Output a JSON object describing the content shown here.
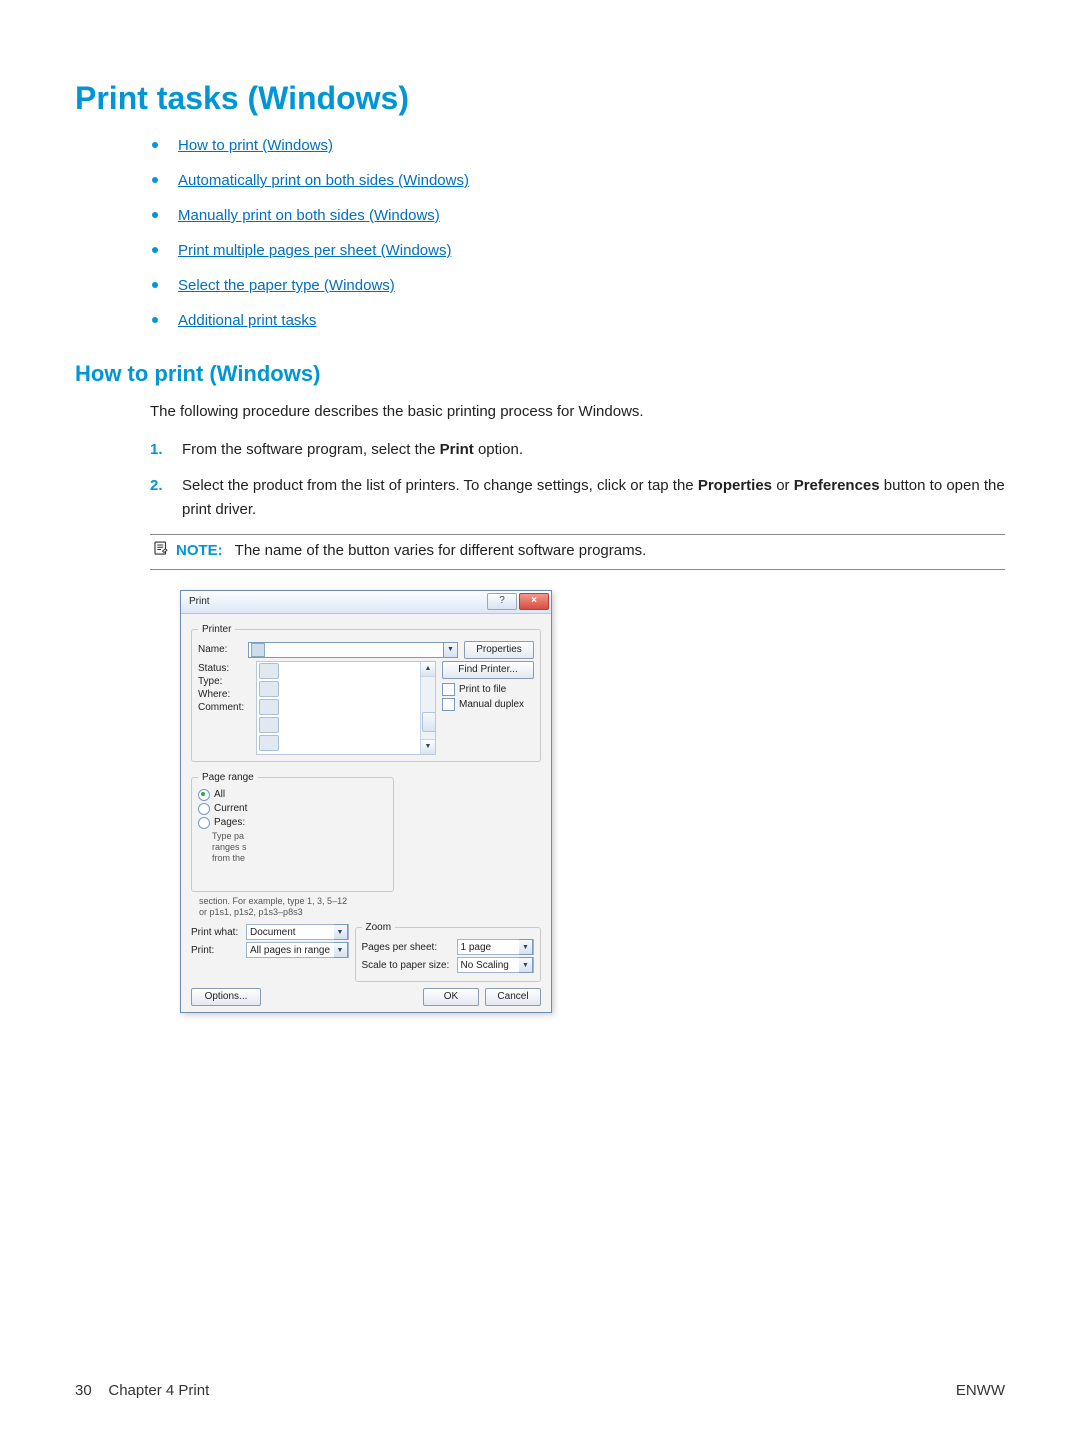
{
  "h1": "Print tasks (Windows)",
  "toc": [
    "How to print (Windows)",
    "Automatically print on both sides (Windows)",
    "Manually print on both sides (Windows)",
    "Print multiple pages per sheet (Windows)",
    "Select the paper type (Windows)",
    "Additional print tasks"
  ],
  "h2": "How to print (Windows)",
  "intro": "The following procedure describes the basic printing process for Windows.",
  "step1_a": "From the software program, select the ",
  "step1_b": "Print",
  "step1_c": " option.",
  "step2_a": "Select the product from the list of printers. To change settings, click or tap the ",
  "step2_b": "Properties",
  "step2_c": " or ",
  "step2_d": "Preferences",
  "step2_e": " button to open the print driver.",
  "note_label": "NOTE:",
  "note_text": "The name of the button varies for different software programs.",
  "dlg": {
    "title": "Print",
    "help_btn": "?",
    "close_btn": "×",
    "printer_group": "Printer",
    "name_lbl": "Name:",
    "status_lbl": "Status:",
    "type_lbl": "Type:",
    "where_lbl": "Where:",
    "comment_lbl": "Comment:",
    "properties_btn": "Properties",
    "find_printer_btn": "Find Printer...",
    "print_to_file": "Print to file",
    "manual_duplex": "Manual duplex",
    "page_range_group": "Page range",
    "range_all": "All",
    "range_current": "Current",
    "range_pages": "Pages:",
    "range_hint1": "Type pa",
    "range_hint2": "ranges s",
    "range_hint3": "from the",
    "range_hint4": "section. For example, type 1, 3, 5–12",
    "range_hint5": "or p1s1, p1s2, p1s3–p8s3",
    "printwhat_lbl": "Print what:",
    "printwhat_val": "Document",
    "print_lbl": "Print:",
    "print_val": "All pages in range",
    "zoom_group": "Zoom",
    "pps_lbl": "Pages per sheet:",
    "pps_val": "1 page",
    "scale_lbl": "Scale to paper size:",
    "scale_val": "No Scaling",
    "options_btn": "Options...",
    "ok_btn": "OK",
    "cancel_btn": "Cancel"
  },
  "footer": {
    "page_no": "30",
    "chapter": "Chapter 4   Print",
    "lang": "ENWW"
  }
}
